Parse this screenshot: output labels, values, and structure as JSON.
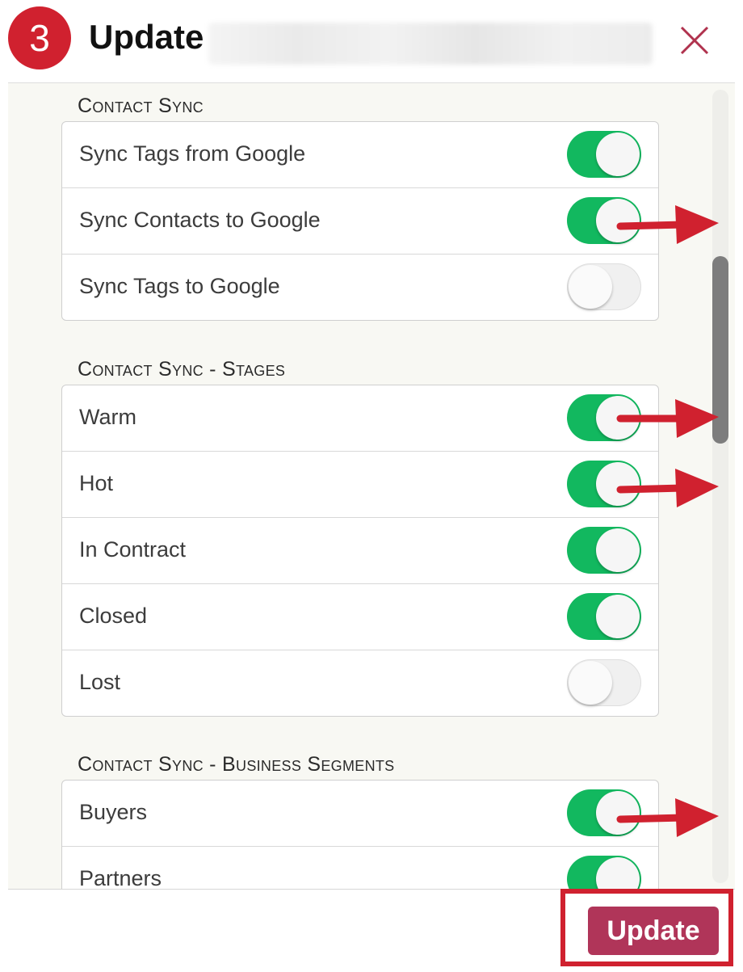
{
  "header": {
    "step_number": "3",
    "title": "Update",
    "close_glyph": "×"
  },
  "sections": [
    {
      "title": "Contact Sync",
      "items": [
        {
          "label": "Sync Tags from Google",
          "on": true
        },
        {
          "label": "Sync Contacts to Google",
          "on": true
        },
        {
          "label": "Sync Tags to Google",
          "on": false
        }
      ]
    },
    {
      "title": "Contact Sync - Stages",
      "items": [
        {
          "label": "Warm",
          "on": true
        },
        {
          "label": "Hot",
          "on": true
        },
        {
          "label": "In Contract",
          "on": true
        },
        {
          "label": "Closed",
          "on": true
        },
        {
          "label": "Lost",
          "on": false
        }
      ]
    },
    {
      "title": "Contact Sync - Business Segments",
      "items": [
        {
          "label": "Buyers",
          "on": true
        },
        {
          "label": "Partners",
          "on": true
        }
      ]
    }
  ],
  "footer": {
    "update_label": "Update"
  },
  "colors": {
    "accent_red": "#d0212f",
    "toggle_on": "#12b85f",
    "update_button": "#b03559"
  }
}
